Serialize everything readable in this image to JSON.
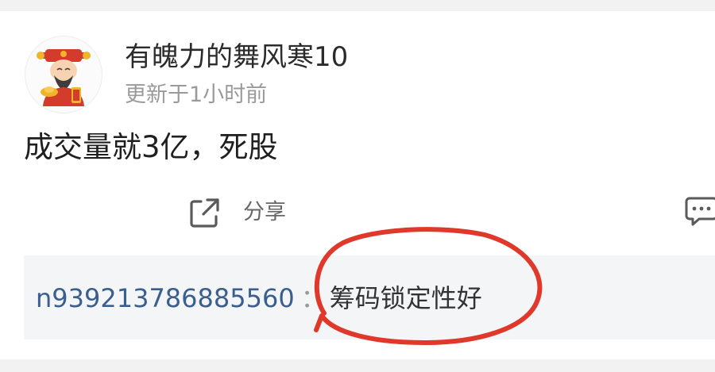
{
  "post": {
    "author": "有魄力的舞风寒10",
    "time": "更新于1小时前",
    "content": "成交量就3亿，死股"
  },
  "actions": {
    "share_label": "分享",
    "share_icon": "share-external-icon",
    "comment_icon": "comment-icon"
  },
  "comment": {
    "user": "n939213786885560",
    "separator": "：",
    "text": "筹码锁定性好"
  },
  "colors": {
    "background": "#f2f2f2",
    "card": "#ffffff",
    "comment_box": "#f4f5f7",
    "username": "#3a5f8f",
    "annotation": "#e0382b"
  }
}
